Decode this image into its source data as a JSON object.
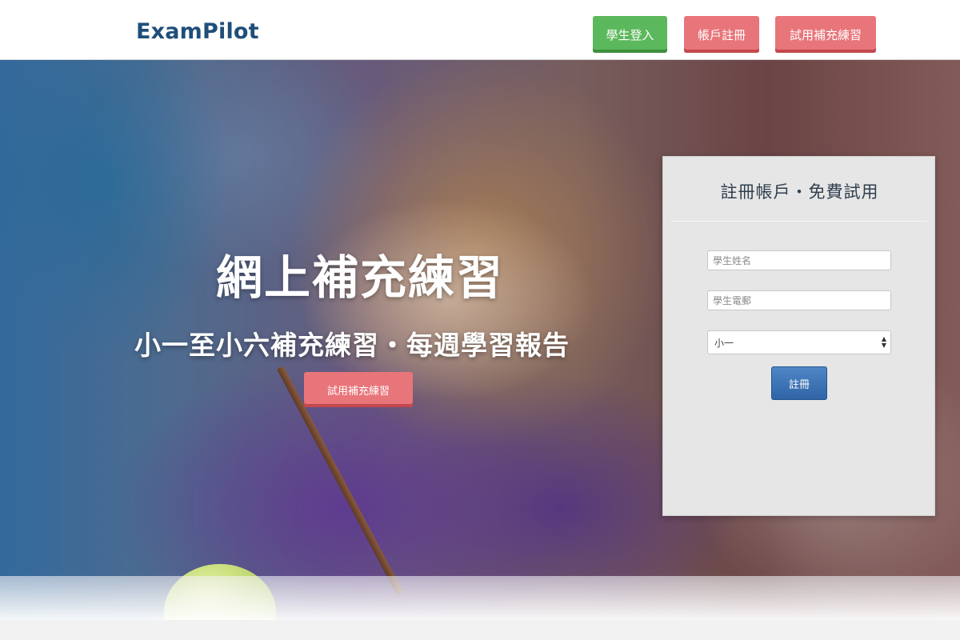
{
  "header": {
    "logo": "ExamPilot",
    "buttons": {
      "login": "學生登入",
      "register": "帳戶註冊",
      "trial": "試用補充練習"
    }
  },
  "hero": {
    "title": "網上補充練習",
    "subtitle": "小一至小六補充練習・每週學習報告",
    "cta": "試用補充練習"
  },
  "register_panel": {
    "title": "註冊帳戶・免費試用",
    "name_placeholder": "學生姓名",
    "email_placeholder": "學生電郵",
    "grade_selected": "小一",
    "submit": "註冊"
  },
  "colors": {
    "brand": "#1f4e7a",
    "green_button": "#5cb85c",
    "red_button": "#e8757a",
    "submit_button": "#3a72b5"
  }
}
